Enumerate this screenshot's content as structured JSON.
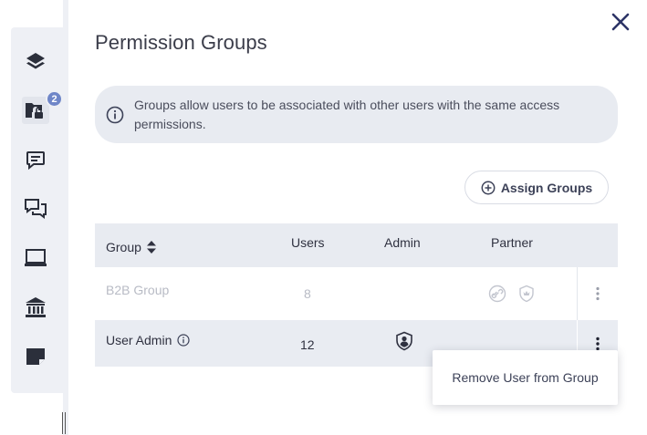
{
  "sidebar": {
    "badge_count": "2",
    "items": [
      {
        "icon": "layers-icon"
      },
      {
        "icon": "folder-lock-icon",
        "active": true
      },
      {
        "icon": "comment-icon"
      },
      {
        "icon": "chat-icon"
      },
      {
        "icon": "laptop-icon"
      },
      {
        "icon": "bank-icon"
      },
      {
        "icon": "note-icon"
      }
    ]
  },
  "panel": {
    "title": "Permission Groups",
    "info_text": "Groups allow users to be associated with other users with the same access permissions.",
    "assign_button_label": "Assign Groups"
  },
  "table": {
    "headers": {
      "group": "Group",
      "users": "Users",
      "admin": "Admin",
      "partner": "Partner"
    },
    "rows": [
      {
        "group": "B2B Group",
        "users": "8",
        "disabled": true,
        "partner_icons": [
          "link-icon",
          "shield-icon"
        ]
      },
      {
        "group": "User Admin",
        "users": "12",
        "admin_icon": "user-shield-icon"
      }
    ]
  },
  "context_menu": {
    "item_label": "Remove User from Group"
  },
  "colors": {
    "accent": "#2c3366",
    "badge": "#6f86c8",
    "header_bg": "#e8ebf1",
    "muted_text": "#b8bbc5"
  }
}
